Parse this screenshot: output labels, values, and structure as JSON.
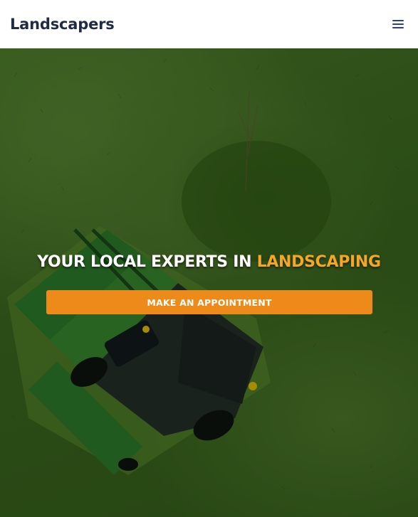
{
  "header": {
    "logo_text": "Landscapers",
    "menu_icon": "hamburger-menu-icon",
    "menu_color": "#2f3c8c"
  },
  "hero": {
    "title_main": "YOUR LOCAL EXPERTS IN",
    "title_accent": "LANDSCAPING",
    "accent_color": "#f5a623",
    "cta_label": "MAKE AN APPOINTMENT",
    "cta_color": "#ee8a1a",
    "background_image": "aerial view of a green riding lawn mower cutting grass"
  }
}
